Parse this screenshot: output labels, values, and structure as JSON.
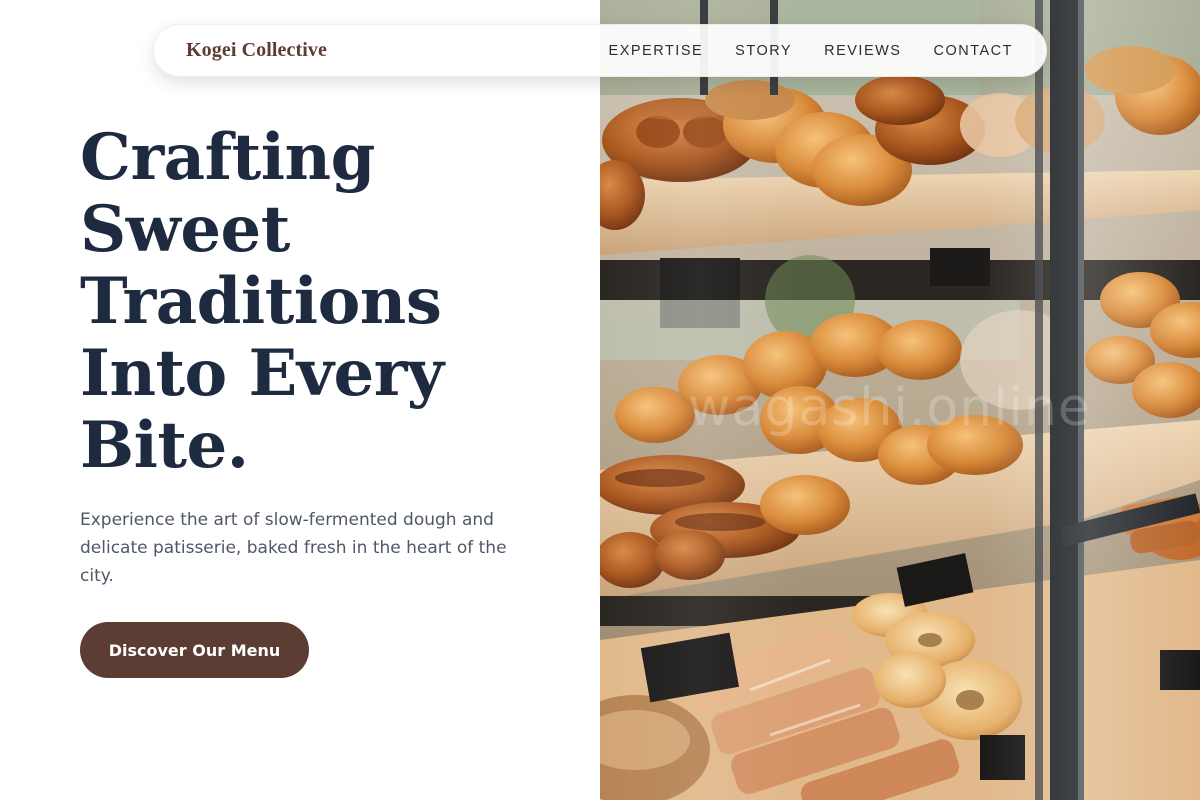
{
  "brand": {
    "name": "Kogei Collective"
  },
  "nav": {
    "links": [
      "EXPERTISE",
      "STORY",
      "REVIEWS",
      "CONTACT"
    ]
  },
  "hero": {
    "title": "Crafting Sweet Traditions Into Every Bite.",
    "subtitle": "Experience the art of slow-fermented dough and delicate patisserie, baked fresh in the heart of the city.",
    "cta_label": "Discover Our Menu",
    "image_watermark": "wagashi.online",
    "image_subject": "bakery-display-case-photo"
  },
  "colors": {
    "brand_brown": "#5c3d33",
    "heading_navy": "#1e2a3f",
    "body_gray": "#4f5866",
    "nav_text": "#2c2c36"
  }
}
